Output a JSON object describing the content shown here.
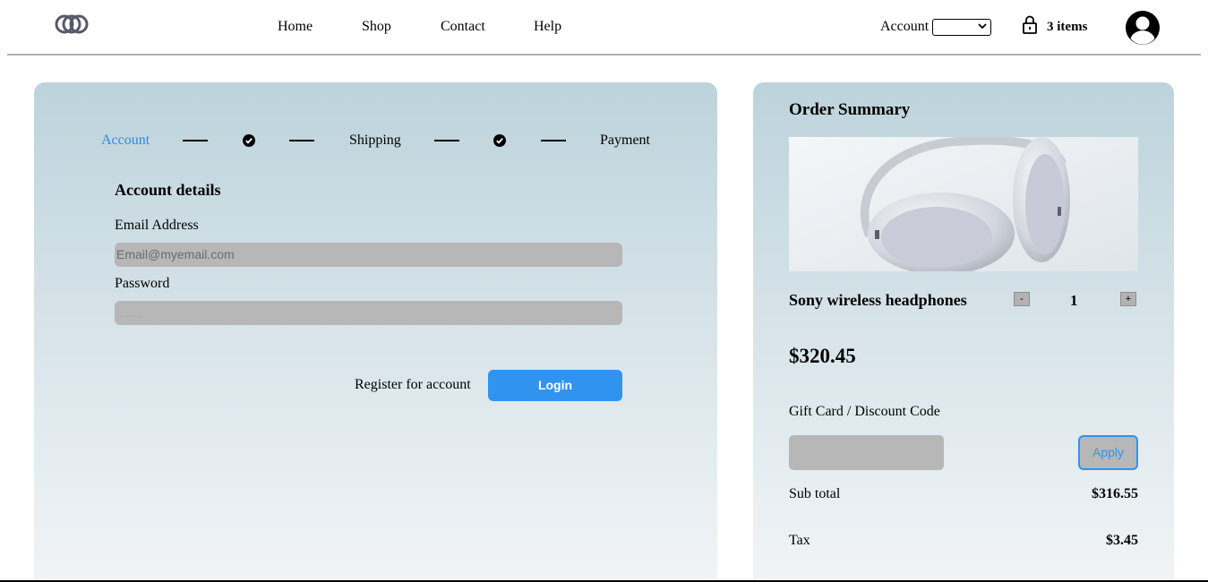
{
  "header": {
    "nav": [
      "Home",
      "Shop",
      "Contact",
      "Help"
    ],
    "account_label": "Account",
    "account_select_value": "",
    "cart_count": "3 items"
  },
  "checkout": {
    "steps": [
      "Account",
      "Shipping",
      "Payment"
    ],
    "active_step": "Account",
    "section_title": "Account details",
    "email_label": "Email Address",
    "email_placeholder": "Email@myemail.com",
    "password_label": "Password",
    "password_placeholder": "........",
    "register_link": "Register for account",
    "login_button": "Login"
  },
  "summary": {
    "title": "Order Summary",
    "product_name": "Sony wireless headphones",
    "qty_minus": "-",
    "quantity": "1",
    "qty_plus": "+",
    "price": "$320.45",
    "discount_label": "Gift Card / Discount Code",
    "apply_button": "Apply",
    "subtotal_label": "Sub total",
    "subtotal_value": "$316.55",
    "tax_label": "Tax",
    "tax_value": "$3.45"
  },
  "colors": {
    "accent": "#3093ef",
    "field_bg": "#b7b7b7",
    "panel_top": "#bdd3dc",
    "panel_bottom": "#f2f5f7"
  },
  "icons": [
    "logo-icon",
    "chevron-down-icon",
    "lock-icon",
    "user-avatar-icon",
    "check-circle-icon"
  ]
}
